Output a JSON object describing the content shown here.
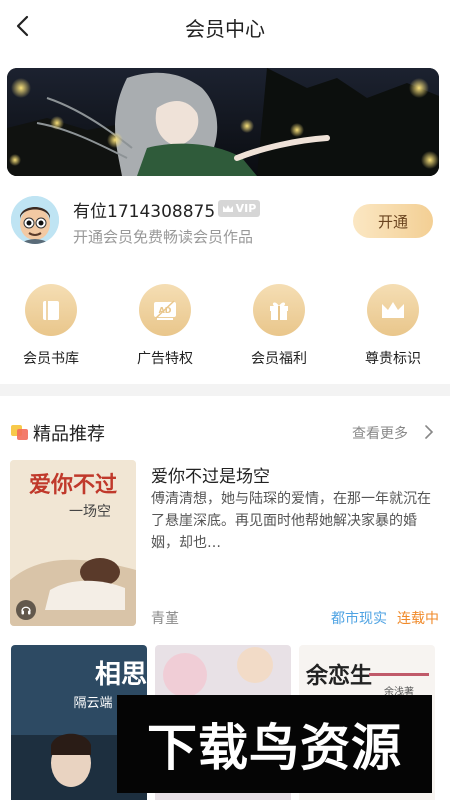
{
  "header": {
    "title": "会员中心"
  },
  "user": {
    "name": "有位1714308875",
    "vip_badge": "VIP",
    "subtitle": "开通会员免费畅读会员作品",
    "open_button": "开通"
  },
  "privileges": [
    {
      "label": "会员书库",
      "icon": "book-icon"
    },
    {
      "label": "广告特权",
      "icon": "ad-icon"
    },
    {
      "label": "会员福利",
      "icon": "gift-icon"
    },
    {
      "label": "尊贵标识",
      "icon": "crown-icon"
    }
  ],
  "recommend": {
    "title": "精品推荐",
    "more": "查看更多",
    "featured": {
      "title": "爱你不过是场空",
      "description": "傅清清想，她与陆琛的爱情，在那一年就沉在了悬崖深底。再见面时他帮她解决家暴的婚姻，却也…",
      "author": "青堇",
      "genre": "都市现实",
      "status": "连载中",
      "cover_text": "爱你不过",
      "cover_subtext": "一场空"
    },
    "grid": [
      {
        "cover_text": "相思",
        "cover_subtext": "隔云端"
      },
      {
        "cover_text": "",
        "cover_subtext": ""
      },
      {
        "cover_text": "余恋生",
        "cover_subtext": "余浅著"
      }
    ]
  },
  "watermark": {
    "text": "下载鸟资源"
  },
  "colors": {
    "gold": "#f3cf94",
    "genre_blue": "#4fa3e3",
    "status_orange": "#f08a2a"
  }
}
